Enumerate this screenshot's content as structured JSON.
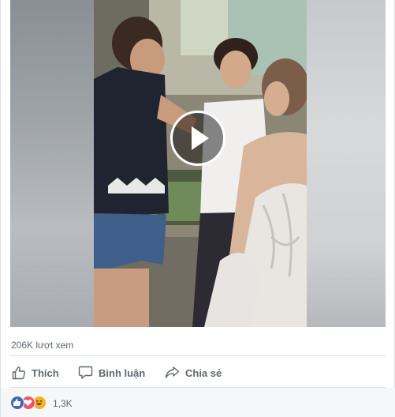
{
  "post": {
    "view_count_text": "206K lượt xem",
    "actions": {
      "like_label": "Thích",
      "comment_label": "Bình luận",
      "share_label": "Chia sẻ"
    },
    "reactions": {
      "count_text": "1,3K",
      "icons": [
        "like-icon",
        "love-icon",
        "haha-icon"
      ]
    }
  },
  "colors": {
    "action_gray": "#606770",
    "like_blue": "#4267b2",
    "love_red": "#f25268",
    "haha_yellow": "#f7b125",
    "footer_bg": "#f6f7f9"
  }
}
